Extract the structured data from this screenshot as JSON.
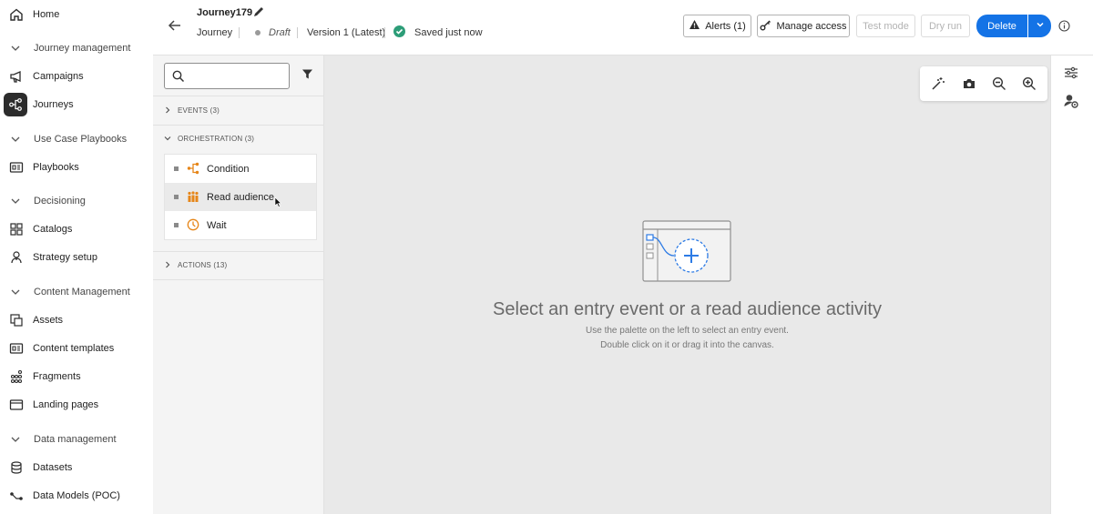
{
  "nav": {
    "home": "Home",
    "journey_management": "Journey management",
    "campaigns": "Campaigns",
    "journeys": "Journeys",
    "use_case_playbooks": "Use Case Playbooks",
    "playbooks": "Playbooks",
    "decisioning": "Decisioning",
    "catalogs": "Catalogs",
    "strategy_setup": "Strategy setup",
    "content_management": "Content Management",
    "assets": "Assets",
    "content_templates": "Content templates",
    "fragments": "Fragments",
    "landing_pages": "Landing pages",
    "data_management": "Data management",
    "datasets": "Datasets",
    "data_models": "Data Models (POC)"
  },
  "header": {
    "title": "Journey179",
    "type": "Journey",
    "status": "Draft",
    "version": "Version 1 (Latest)",
    "saved": "Saved just now",
    "alerts": "Alerts (1)",
    "manage_access": "Manage access",
    "test_mode": "Test mode",
    "dry_run": "Dry run",
    "delete": "Delete"
  },
  "palette": {
    "search_placeholder": "",
    "events": "EVENTS (3)",
    "orchestration": "ORCHESTRATION (3)",
    "actions": "ACTIONS (13)",
    "items": [
      {
        "label": "Condition"
      },
      {
        "label": "Read audience"
      },
      {
        "label": "Wait"
      }
    ]
  },
  "canvas": {
    "empty_title": "Select an entry event or a read audience activity",
    "empty_line1": "Use the palette on the left to select an entry event.",
    "empty_line2": "Double click on it or drag it into the canvas."
  },
  "colors": {
    "accent": "#1473e6",
    "success": "#2d9d78",
    "orchestration": "#e68619"
  }
}
